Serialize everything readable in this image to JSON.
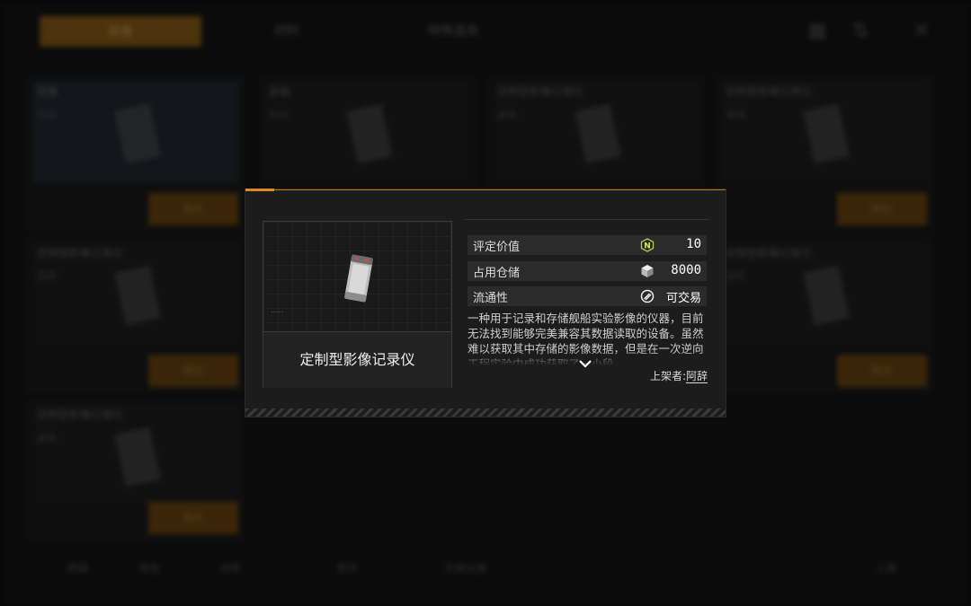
{
  "background": {
    "tabs": [
      "装备",
      "材料",
      "特殊道具"
    ],
    "cards": [
      {
        "title": "装备",
        "sub": "对战"
      },
      {
        "title": "装备",
        "sub": "对战"
      },
      {
        "title": "定制型影像记录仪",
        "sub": "道具"
      },
      {
        "title": "定制型影像记录仪",
        "sub": "道具"
      },
      {
        "title": "定制型影像记录仪",
        "sub": "道具"
      },
      {
        "title": "定制型影像记录仪",
        "sub": "道具"
      },
      {
        "title": "定制型影像记录仪",
        "sub": "道具"
      }
    ],
    "buy_label": "购买",
    "bottom_items": [
      "商城",
      "背包",
      "仓库",
      "货币",
      "交易记录",
      "上架"
    ]
  },
  "modal": {
    "item_name": "定制型影像记录仪",
    "rows": [
      {
        "label": "评定价值",
        "icon": "n-coin-icon",
        "value": "10"
      },
      {
        "label": "占用仓储",
        "icon": "cube-icon",
        "value": "8000"
      },
      {
        "label": "流通性",
        "icon": "trade-icon",
        "value": "可交易"
      }
    ],
    "description": "一种用于记录和存储舰船实验影像的仪器，目前无法找到能够完美兼容其数据读取的设备。虽然难以获取其中存储的影像数据，但是在一次逆向工程实验中成功获取了一小段",
    "seller_label": "上架者:",
    "seller_name": "阿辞",
    "accent_color": "#e08a1e"
  }
}
